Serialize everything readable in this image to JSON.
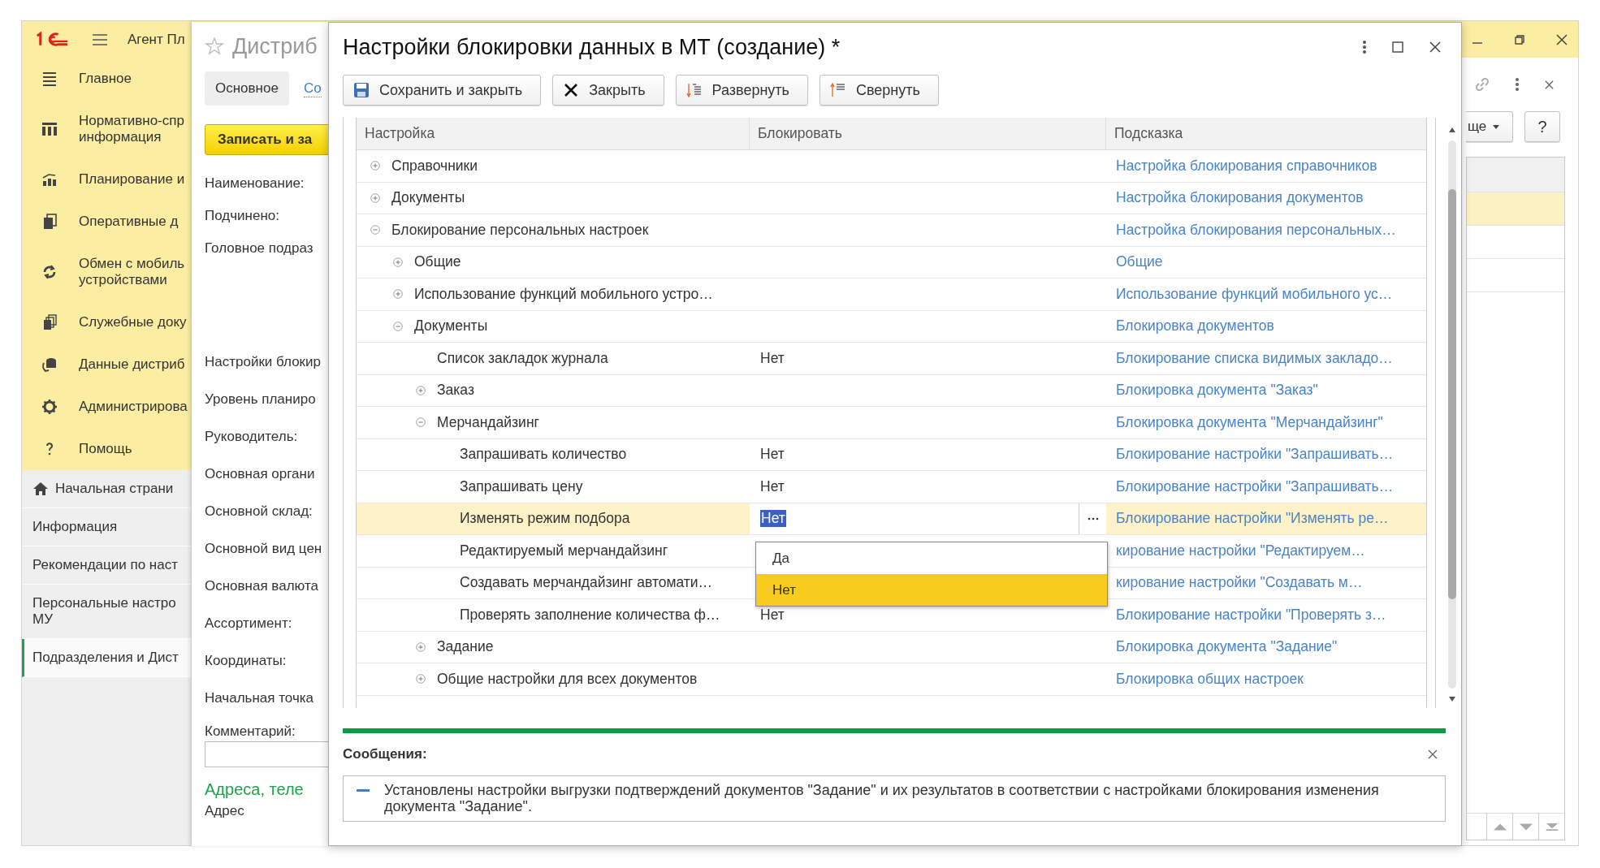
{
  "main_window": {
    "app_title": "Агент Пл",
    "nav_items": [
      {
        "label": "Главное"
      },
      {
        "label": "Нормативно-спр\nинформация"
      },
      {
        "label": "Планирование и"
      },
      {
        "label": "Оперативные д"
      },
      {
        "label": "Обмен с мобиль\nустройствами"
      },
      {
        "label": "Служебные доку"
      },
      {
        "label": "Данные дистриб"
      },
      {
        "label": "Администрирова"
      },
      {
        "label": "Помощь"
      }
    ],
    "open_items": [
      {
        "label": "Начальная страни",
        "selected": false
      },
      {
        "label": "Информация",
        "selected": false
      },
      {
        "label": "Рекомендации по наст",
        "selected": false
      },
      {
        "label": "Персональные настро\nМУ",
        "selected": false
      },
      {
        "label": "Подразделения и Дист",
        "selected": true
      }
    ],
    "right_panel": {
      "more_button": "ще",
      "help_button": "?",
      "list_rows": [
        {
          "selected": false
        },
        {
          "selected": true
        },
        {
          "selected": false
        },
        {
          "selected": false
        }
      ]
    }
  },
  "form": {
    "title": "Дистриб",
    "tabs": [
      {
        "label": "Основное",
        "selected": true
      },
      {
        "label": "Со",
        "selected": false
      }
    ],
    "save_button": "Записать и за",
    "fields_top": [
      "Наименование:",
      "Подчинено:",
      "Головное подраз"
    ],
    "fields": [
      "Настройки блокир",
      "Уровень планиро",
      "Руководитель:",
      "Основная органи",
      "Основной склад:",
      "Основной вид цен",
      "Основная валюта",
      "Ассортимент:",
      "Координаты:",
      "Начальная точка"
    ],
    "comment_label": "Комментарий:",
    "section_title": "Адреса, теле",
    "address_label": "Адрес"
  },
  "dialog": {
    "title": "Настройки блокировки данных в МТ (создание) *",
    "toolbar": [
      "Сохранить и закрыть",
      "Закрыть",
      "Развернуть",
      "Свернуть"
    ],
    "columns": [
      "Настройка",
      "Блокировать",
      "Подсказка"
    ],
    "rows": [
      {
        "kind": "group",
        "label": "Справочники",
        "expanded": false,
        "selected": false,
        "hint": "Настройка блокирования справочников"
      },
      {
        "kind": "group",
        "label": "Документы",
        "expanded": false,
        "selected": false,
        "hint": "Настройка блокирования документов"
      },
      {
        "kind": "group",
        "label": "Блокирование персональных настроек",
        "expanded": true,
        "selected": false,
        "hint": "Настройка блокирования персональных…",
        "children": [
          {
            "kind": "group",
            "label": "Общие",
            "expanded": false,
            "selected": false,
            "hint": "Общие"
          },
          {
            "kind": "group",
            "label": "Использование функций мобильного устро…",
            "expanded": false,
            "selected": false,
            "hint": "Использование функций мобильного ус…"
          },
          {
            "kind": "group",
            "label": "Документы",
            "expanded": true,
            "selected": false,
            "hint": "Блокировка документов",
            "children": [
              {
                "kind": "setting",
                "label": "Список закладок журнала",
                "value": "Нет",
                "selected": false,
                "hint": "Блокирование списка видимых закладо…"
              },
              {
                "kind": "group",
                "label": "Заказ",
                "expanded": false,
                "selected": false,
                "hint": "Блокировка документа \"Заказ\""
              },
              {
                "kind": "group",
                "label": "Мерчандайзинг",
                "expanded": true,
                "selected": false,
                "hint": "Блокировка документа \"Мерчандайзинг\"",
                "children": [
                  {
                    "kind": "setting",
                    "label": "Запрашивать количество",
                    "value": "Нет",
                    "selected": false,
                    "hint": "Блокирование настройки \"Запрашивать…"
                  },
                  {
                    "kind": "setting",
                    "label": "Запрашивать цену",
                    "value": "Нет",
                    "selected": false,
                    "hint": "Блокирование настройки \"Запрашивать…"
                  },
                  {
                    "kind": "setting",
                    "label": "Изменять режим подбора",
                    "value": "Нет",
                    "selected": true,
                    "hint": "Блокирование настройки \"Изменять ре…"
                  },
                  {
                    "kind": "setting",
                    "label": "Редактируемый мерчандайзинг",
                    "selected": false,
                    "hint": "кирование настройки \"Редактируем…"
                  },
                  {
                    "kind": "setting",
                    "label": "Создавать мерчандайзинг автомати…",
                    "selected": false,
                    "hint": "кирование настройки \"Создавать м…"
                  },
                  {
                    "kind": "setting",
                    "label": "Проверять заполнение количества ф…",
                    "value": "Нет",
                    "selected": false,
                    "hint": "Блокирование настройки \"Проверять з…"
                  }
                ]
              },
              {
                "kind": "group",
                "label": "Задание",
                "expanded": false,
                "selected": false,
                "hint": "Блокировка документа \"Задание\""
              },
              {
                "kind": "group",
                "label": "Общие настройки для всех документов",
                "expanded": false,
                "selected": false,
                "hint": "Блокировка общих настроек"
              }
            ]
          }
        ]
      }
    ],
    "dropdown": {
      "options": [
        {
          "label": "Да",
          "selected": false
        },
        {
          "label": "Нет",
          "selected": true
        }
      ]
    },
    "messages": {
      "title": "Сообщения:",
      "items": [
        "Установлены настройки выгрузки подтверждений документов \"Задание\" и их результатов в соответствии с настройками блокирования изменения документа \"Задание\"."
      ]
    }
  }
}
